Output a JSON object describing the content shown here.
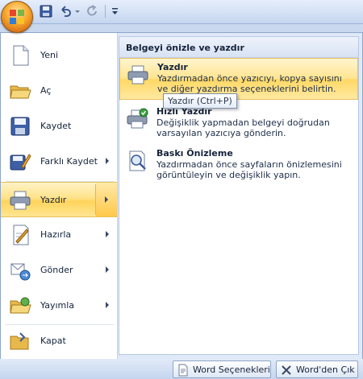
{
  "colors": {
    "menu_bg": "#dfe9f7",
    "highlight": "#ffd863",
    "header_bg": "#d7e2f3",
    "text": "#15233b"
  },
  "quick_access": {
    "icons": [
      "office-logo-icon",
      "save-icon",
      "undo-icon",
      "redo-icon",
      "customize-dropdown-icon"
    ]
  },
  "left_menu": {
    "items": [
      {
        "label": "Yeni",
        "icon": "new-document-icon",
        "has_submenu": false
      },
      {
        "label": "Aç",
        "icon": "open-folder-icon",
        "has_submenu": false
      },
      {
        "label": "Kaydet",
        "icon": "save-disk-icon",
        "has_submenu": false
      },
      {
        "label": "Farklı Kaydet",
        "icon": "save-as-icon",
        "has_submenu": true
      },
      {
        "label": "Yazdır",
        "icon": "printer-icon",
        "has_submenu": true,
        "active": true
      },
      {
        "label": "Hazırla",
        "icon": "prepare-icon",
        "has_submenu": true
      },
      {
        "label": "Gönder",
        "icon": "send-icon",
        "has_submenu": true
      },
      {
        "label": "Yayımla",
        "icon": "publish-icon",
        "has_submenu": true
      },
      {
        "label": "Kapat",
        "icon": "close-folder-icon",
        "has_submenu": false
      }
    ]
  },
  "submenu": {
    "header": "Belgeyi önizle ve yazdır",
    "options": [
      {
        "title": "Yazdır",
        "description": "Yazdırmadan önce yazıcıyı, kopya sayısını ve diğer yazdırma seçeneklerini belirtin.",
        "icon": "print-dialog-icon",
        "highlighted": true
      },
      {
        "title": "Hızlı Yazdır",
        "description": "Değişiklik yapmadan belgeyi doğrudan varsayılan yazıcıya gönderin.",
        "icon": "quick-print-icon",
        "highlighted": false
      },
      {
        "title": "Baskı Önizleme",
        "description": "Yazdırmadan önce sayfaların önizlemesini görüntüleyin ve değişiklik yapın.",
        "icon": "print-preview-icon",
        "highlighted": false
      }
    ]
  },
  "tooltip": {
    "text": "Yazdır (Ctrl+P)"
  },
  "footer": {
    "options_label": "Word Seçenekleri",
    "exit_label": "Word'den Çık"
  }
}
